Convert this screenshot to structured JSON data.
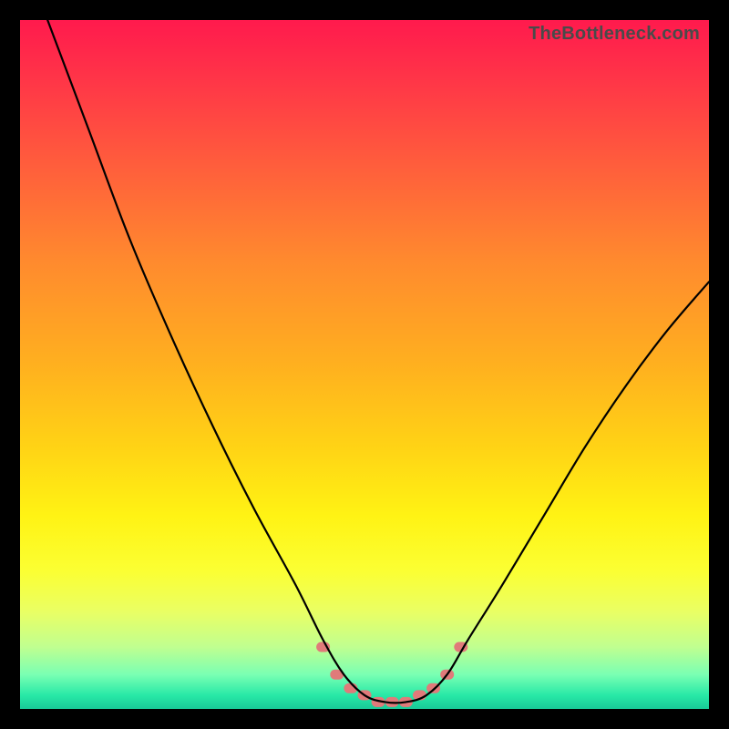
{
  "watermark": "TheBottleneck.com",
  "chart_data": {
    "type": "line",
    "title": "",
    "xlabel": "",
    "ylabel": "",
    "xlim": [
      0,
      100
    ],
    "ylim": [
      0,
      100
    ],
    "grid": false,
    "legend": false,
    "series": [
      {
        "name": "bottleneck-curve",
        "x": [
          4,
          10,
          16,
          22,
          28,
          34,
          40,
          44,
          47,
          50,
          53,
          56,
          59,
          62,
          65,
          70,
          76,
          82,
          88,
          94,
          100
        ],
        "values": [
          100,
          84,
          68,
          54,
          41,
          29,
          18,
          10,
          5,
          2,
          1,
          1,
          2,
          5,
          10,
          18,
          28,
          38,
          47,
          55,
          62
        ]
      }
    ],
    "markers": {
      "name": "highlight-dots",
      "x": [
        44,
        46,
        48,
        50,
        52,
        54,
        56,
        58,
        60,
        62,
        64
      ],
      "values": [
        9,
        5,
        3,
        2,
        1,
        1,
        1,
        2,
        3,
        5,
        9
      ]
    },
    "gradient_stops": [
      {
        "pos": 0,
        "color": "#ff1a4d"
      },
      {
        "pos": 50,
        "color": "#ffb01f"
      },
      {
        "pos": 80,
        "color": "#fbff33"
      },
      {
        "pos": 100,
        "color": "#19c998"
      }
    ]
  }
}
